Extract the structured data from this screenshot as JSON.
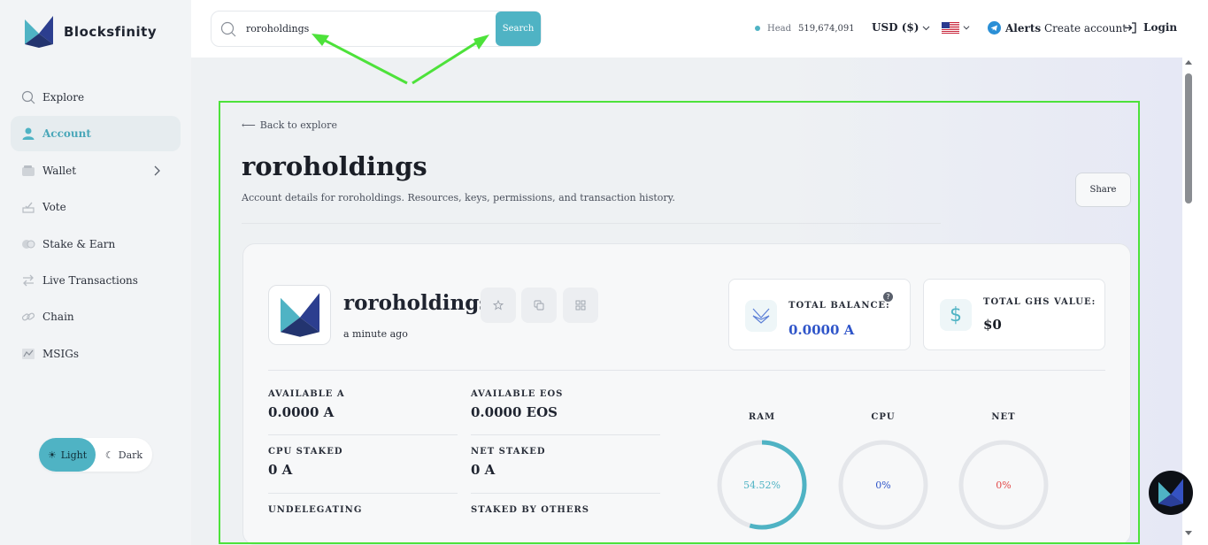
{
  "brand": {
    "name": "Blocksfinity"
  },
  "sidebar": {
    "items": [
      {
        "label": "Explore",
        "icon": "search-icon",
        "active": false
      },
      {
        "label": "Account",
        "icon": "user-icon",
        "active": true
      },
      {
        "label": "Wallet",
        "icon": "wallet-icon",
        "active": false,
        "has_children": true
      },
      {
        "label": "Vote",
        "icon": "vote-icon",
        "active": false
      },
      {
        "label": "Stake & Earn",
        "icon": "coins-icon",
        "active": false
      },
      {
        "label": "Live Transactions",
        "icon": "transfer-arrows-icon",
        "active": false
      },
      {
        "label": "Chain",
        "icon": "link-icon",
        "active": false
      },
      {
        "label": "MSIGs",
        "icon": "signature-icon",
        "active": false
      }
    ],
    "theme": {
      "light_label": "Light",
      "dark_label": "Dark",
      "selected": "Light"
    }
  },
  "topbar": {
    "search_value": "roroholdings",
    "search_button": "Search",
    "head_label": "Head",
    "head_value": "519,674,091",
    "currency": "USD ($)",
    "language_flag": "us-flag-icon",
    "alerts": "Alerts",
    "create_account": "Create account",
    "login": "Login"
  },
  "page": {
    "back_link": "Back to explore",
    "title": "roroholdings",
    "subtitle": "Account details for roroholdings. Resources, keys, permissions, and transaction history.",
    "share_button": "Share"
  },
  "account": {
    "name": "roroholdings",
    "created": "a minute ago",
    "total_balance_label": "TOTAL BALANCE:",
    "total_balance_value": "0.0000 A",
    "total_ghs_label": "TOTAL GHS VALUE:",
    "total_ghs_value": "$0",
    "stats": [
      {
        "label": "AVAILABLE A",
        "value": "0.0000 A"
      },
      {
        "label": "AVAILABLE EOS",
        "value": "0.0000 EOS"
      },
      {
        "label": "CPU STAKED",
        "value": "0 A"
      },
      {
        "label": "NET STAKED",
        "value": "0 A"
      },
      {
        "label": "UNDELEGATING",
        "value": ""
      },
      {
        "label": "STAKED BY OTHERS",
        "value": ""
      }
    ],
    "resources": [
      {
        "label": "RAM",
        "percent_text": "54.52%",
        "fraction": 0.5452,
        "color": "#4fb3c4"
      },
      {
        "label": "CPU",
        "percent_text": "0%",
        "fraction": 0,
        "color": "#2f55c9"
      },
      {
        "label": "NET",
        "percent_text": "0%",
        "fraction": 0,
        "color": "#e24a4a"
      }
    ]
  },
  "colors": {
    "accent": "#4fb3c4",
    "annotation": "#4de23a",
    "balance": "#2f55c9"
  }
}
